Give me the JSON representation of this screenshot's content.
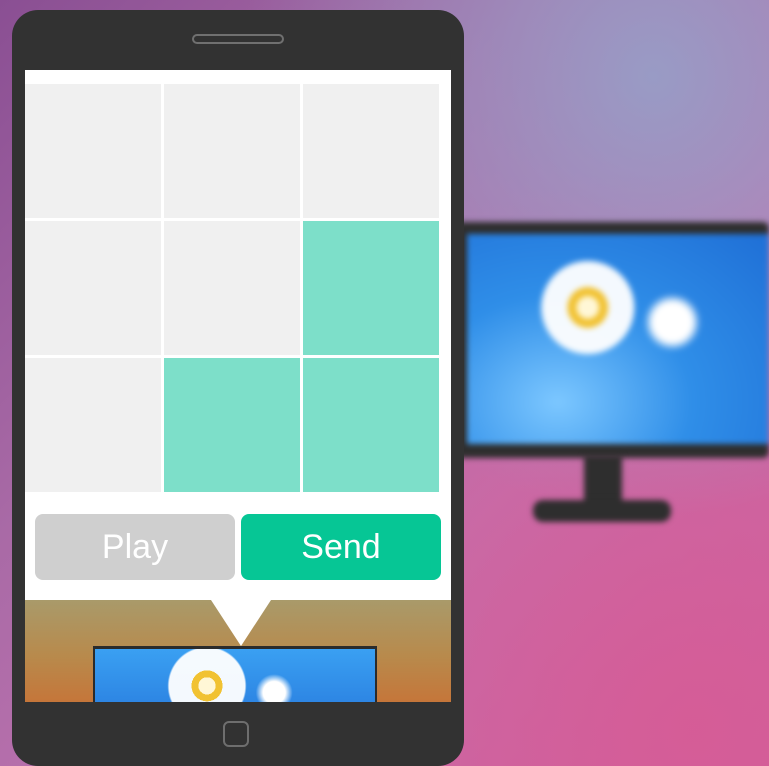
{
  "buttons": {
    "play_label": "Play",
    "send_label": "Send"
  },
  "grid": {
    "rows": 3,
    "cols": 3,
    "cells": [
      [
        false,
        false,
        false
      ],
      [
        false,
        false,
        true
      ],
      [
        false,
        true,
        true
      ]
    ],
    "on_color": "#7ddfc9",
    "off_color": "#f0f0f0"
  },
  "colors": {
    "send_button": "#06c695",
    "play_button": "#cfcfcf"
  },
  "icons": {
    "speaker": "speaker-grille-icon",
    "home": "home-button-icon"
  }
}
